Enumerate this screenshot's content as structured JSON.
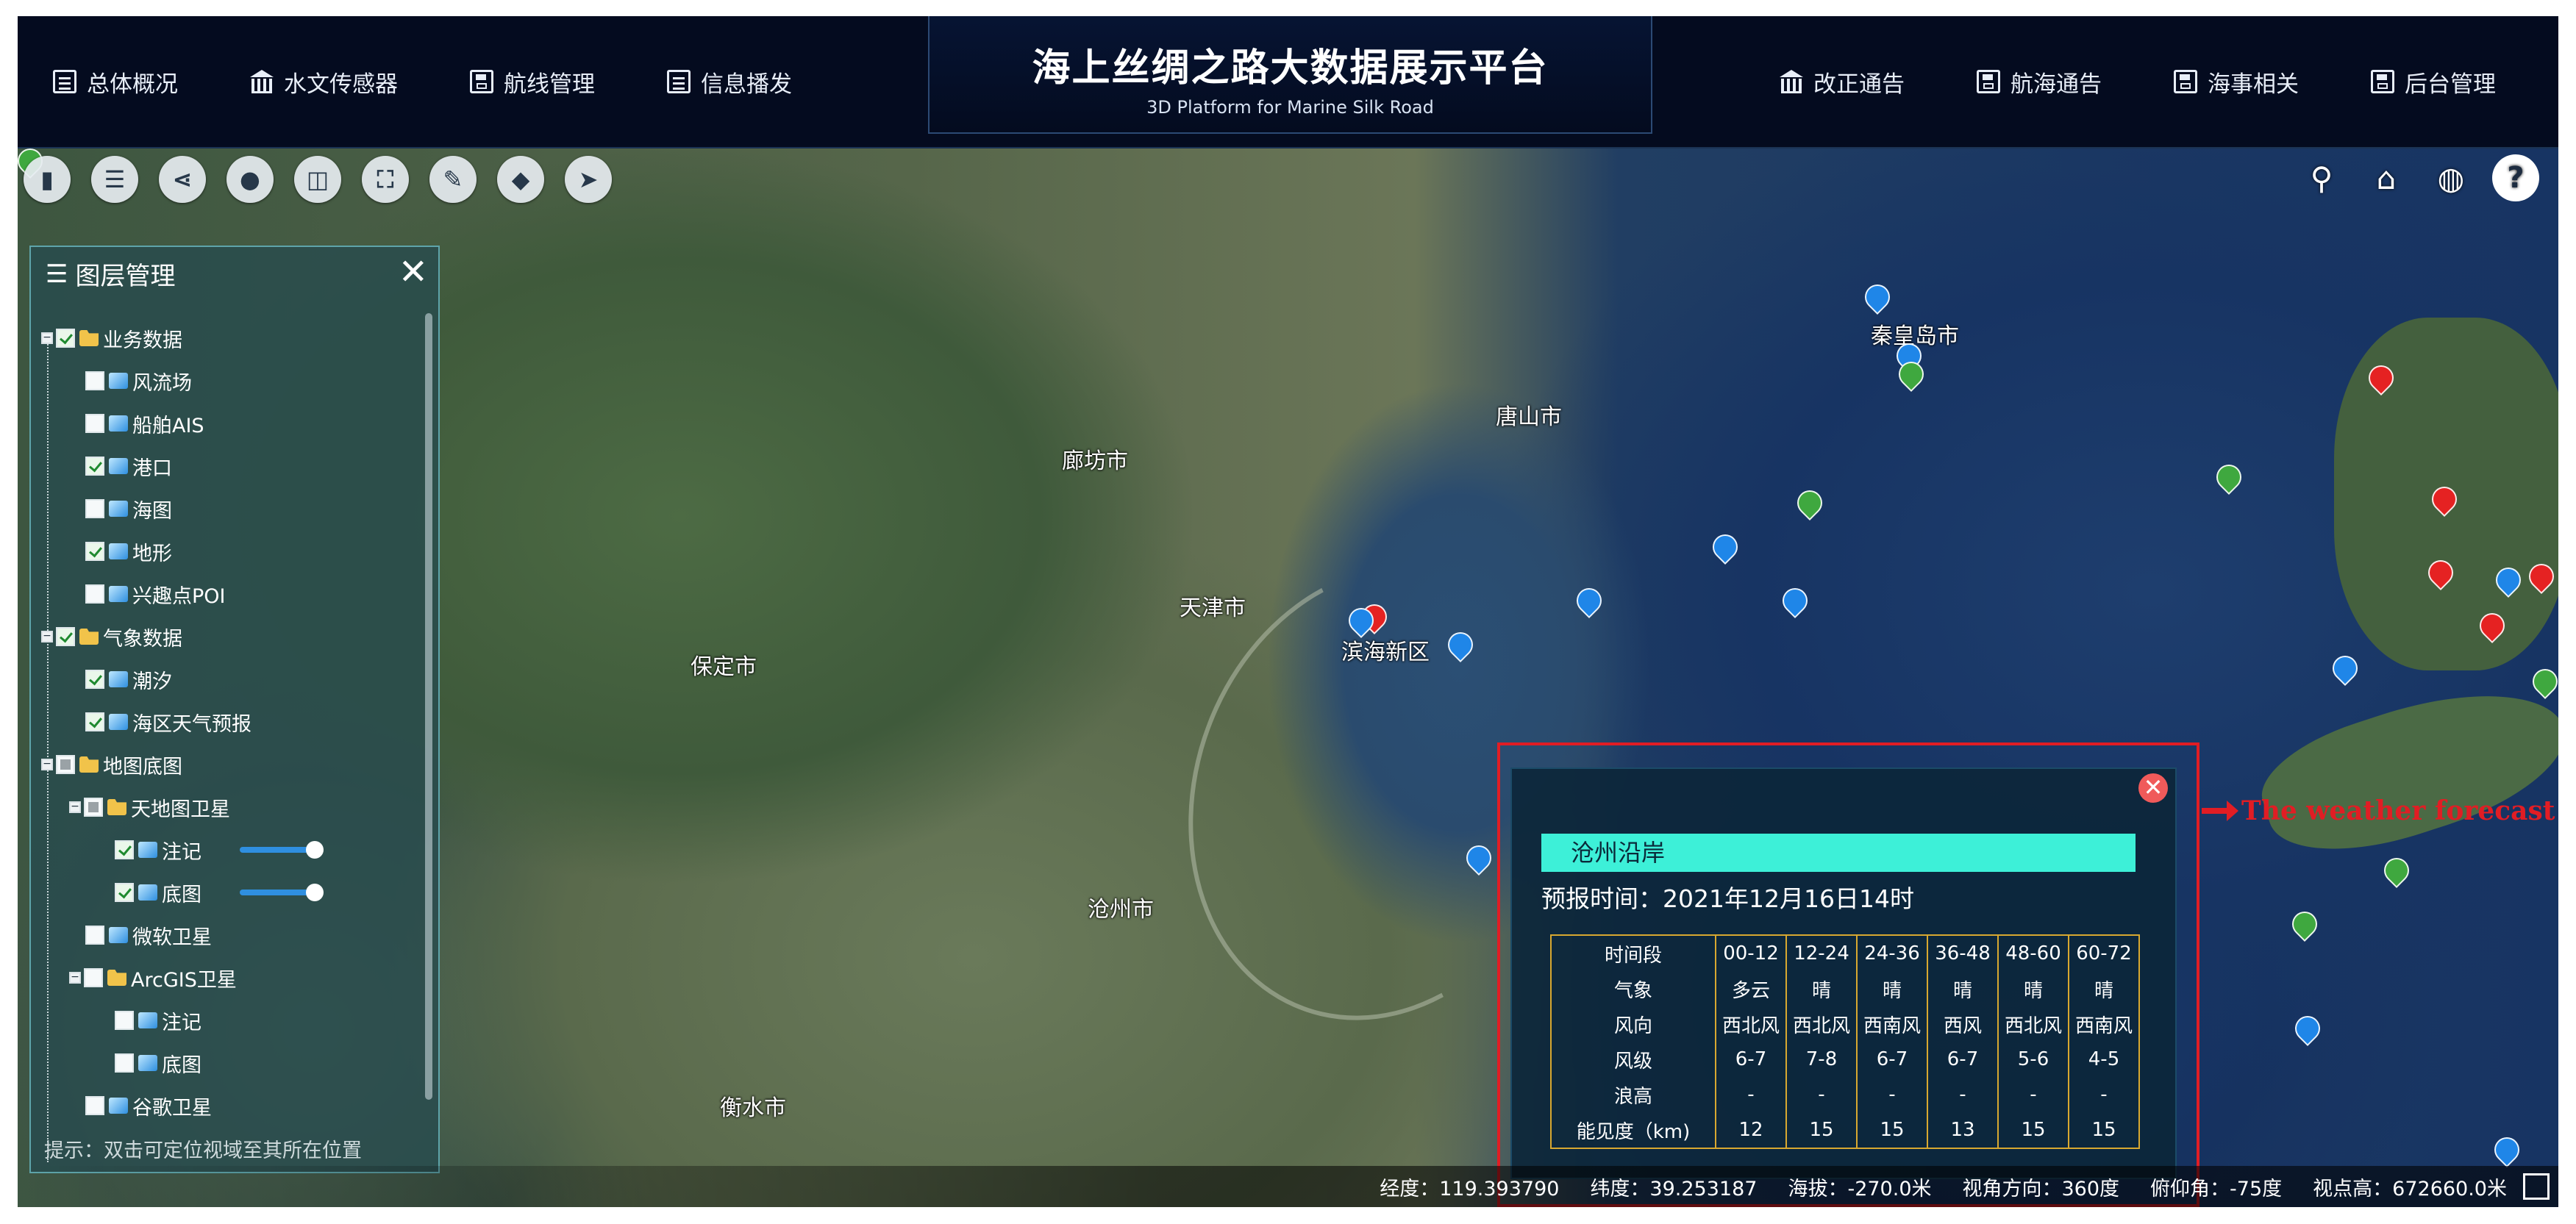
{
  "header": {
    "title": "海上丝绸之路大数据展示平台",
    "subtitle": "3D Platform for Marine Silk Road",
    "left_nav": [
      {
        "label": "总体概况",
        "icon": "document-icon"
      },
      {
        "label": "水文传感器",
        "icon": "bank-icon"
      },
      {
        "label": "航线管理",
        "icon": "save-icon"
      },
      {
        "label": "信息播发",
        "icon": "document-icon"
      }
    ],
    "right_nav": [
      {
        "label": "改正通告",
        "icon": "bank-icon"
      },
      {
        "label": "航海通告",
        "icon": "save-icon"
      },
      {
        "label": "海事相关",
        "icon": "save-icon"
      },
      {
        "label": "后台管理",
        "icon": "save-icon"
      }
    ]
  },
  "toolbar": [
    "map-icon",
    "list-icon",
    "share-icon",
    "pin-icon",
    "split-view-icon",
    "screenshot-icon",
    "edit-icon",
    "tag-icon",
    "send-icon"
  ],
  "right_tools": [
    "search-icon",
    "home-icon",
    "globe-icon",
    "help-icon"
  ],
  "map_labels": [
    "保定市",
    "沧州市",
    "廊坊市",
    "唐山市",
    "衡水市",
    "秦皇岛市",
    "天津市",
    "滨海新区"
  ],
  "layer_panel": {
    "title": "图层管理",
    "close": "✕",
    "hint": "提示：双击可定位视域至其所在位置",
    "tree": [
      {
        "label": "业务数据",
        "level": 0,
        "checked": true,
        "type": "folder"
      },
      {
        "label": "风流场",
        "level": 1,
        "checked": false,
        "type": "layer"
      },
      {
        "label": "船舶AIS",
        "level": 1,
        "checked": false,
        "type": "layer"
      },
      {
        "label": "港口",
        "level": 1,
        "checked": true,
        "type": "layer"
      },
      {
        "label": "海图",
        "level": 1,
        "checked": false,
        "type": "layer"
      },
      {
        "label": "地形",
        "level": 1,
        "checked": true,
        "type": "layer"
      },
      {
        "label": "兴趣点POI",
        "level": 1,
        "checked": false,
        "type": "layer"
      },
      {
        "label": "气象数据",
        "level": 0,
        "checked": true,
        "type": "folder"
      },
      {
        "label": "潮汐",
        "level": 1,
        "checked": true,
        "type": "layer"
      },
      {
        "label": "海区天气预报",
        "level": 1,
        "checked": true,
        "type": "layer"
      },
      {
        "label": "地图底图",
        "level": 0,
        "checked": "partial",
        "type": "folder"
      },
      {
        "label": "天地图卫星",
        "level": 1,
        "checked": "partial",
        "type": "folder"
      },
      {
        "label": "注记",
        "level": 2,
        "checked": true,
        "type": "layer",
        "opacity": 1.0
      },
      {
        "label": "底图",
        "level": 2,
        "checked": true,
        "type": "layer",
        "opacity": 1.0
      },
      {
        "label": "微软卫星",
        "level": 1,
        "checked": false,
        "type": "layer"
      },
      {
        "label": "ArcGIS卫星",
        "level": 1,
        "checked": false,
        "type": "folder"
      },
      {
        "label": "注记",
        "level": 2,
        "checked": false,
        "type": "layer"
      },
      {
        "label": "底图",
        "level": 2,
        "checked": false,
        "type": "layer"
      },
      {
        "label": "谷歌卫星",
        "level": 1,
        "checked": false,
        "type": "layer"
      }
    ]
  },
  "popup": {
    "title": "沧州沿岸",
    "forecast_time": "预报时间：2021年12月16日14时",
    "table": [
      [
        "时间段",
        "00-12",
        "12-24",
        "24-36",
        "36-48",
        "48-60",
        "60-72"
      ],
      [
        "气象",
        "多云",
        "晴",
        "晴",
        "晴",
        "晴",
        "晴"
      ],
      [
        "风向",
        "西北风",
        "西北风",
        "西南风",
        "西风",
        "西北风",
        "西南风"
      ],
      [
        "风级",
        "6-7",
        "7-8",
        "6-7",
        "6-7",
        "5-6",
        "4-5"
      ],
      [
        "浪高",
        "-",
        "-",
        "-",
        "-",
        "-",
        "-"
      ],
      [
        "能见度（km)",
        "12",
        "15",
        "15",
        "13",
        "15",
        "15"
      ]
    ]
  },
  "annotation": "The weather forecast",
  "status": {
    "lon": "经度：119.393790",
    "lat": "纬度：39.253187",
    "alt": "海拔：-270.0米",
    "heading": "视角方向：360度",
    "pitch": "俯仰角：-75度",
    "height": "视点高：672660.0米"
  },
  "colors": {
    "accent_red": "#e11d24",
    "title_teal": "#3df0d8",
    "header_bg": "#040b1f"
  }
}
